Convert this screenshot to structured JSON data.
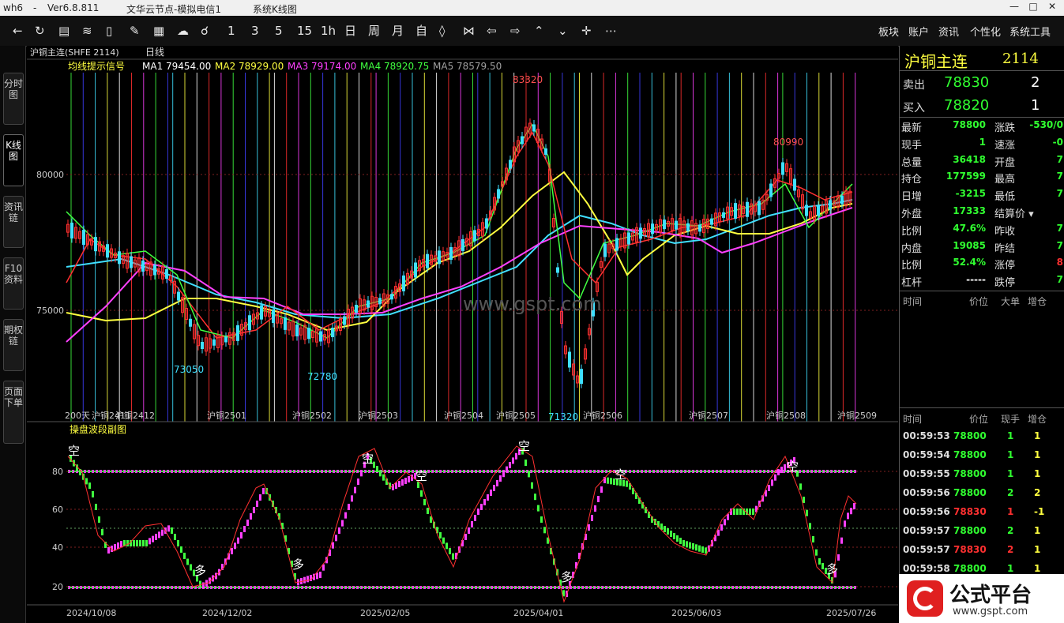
{
  "titlebar": {
    "app": "wh6",
    "version": "Ver6.8.811",
    "server": "文华云节点-模拟电信1",
    "view": "系统K线图"
  },
  "toolbar": {
    "periods": [
      "1",
      "3",
      "5",
      "15",
      "1h",
      "日",
      "周",
      "月",
      "自"
    ],
    "menus": [
      "板块",
      "账户",
      "资讯",
      "个性化",
      "系统工具"
    ]
  },
  "leftbar": {
    "tabs": [
      "分时图",
      "K线图",
      "资讯链",
      "F10资料",
      "期权链",
      "页面下单"
    ]
  },
  "chart": {
    "symbol_label": "沪铜主连(SHFE 2114)",
    "period_label": "日线",
    "indicator_label": "均线提示信号",
    "ma": [
      {
        "name": "MA1",
        "value": "79454.00",
        "color": "#ffffff"
      },
      {
        "name": "MA2",
        "value": "78929.00",
        "color": "#ffff40"
      },
      {
        "name": "MA3",
        "value": "79174.00",
        "color": "#ff40ff"
      },
      {
        "name": "MA4",
        "value": "78920.75",
        "color": "#40ff40"
      },
      {
        "name": "MA5",
        "value": "78579.50",
        "color": "#a0a0a0"
      }
    ],
    "y_ticks": [
      "80000",
      "75000"
    ],
    "annotations": [
      "83320",
      "80990",
      "73050",
      "72780",
      "71320"
    ],
    "contracts": [
      "200天",
      "沪铜2411",
      "沪铜2412",
      "沪铜2501",
      "沪铜2502",
      "沪铜2503",
      "沪铜2504",
      "沪铜2505",
      "沪铜2506",
      "沪铜2507",
      "沪铜2508",
      "沪铜2509"
    ],
    "watermark": "www.gspt.com",
    "sub_label": "操盘波段副图",
    "sub_ticks": [
      "80",
      "60",
      "40",
      "20"
    ],
    "sub_marks": [
      "空",
      "空",
      "空",
      "空",
      "空",
      "空",
      "多",
      "多",
      "多",
      "多"
    ],
    "dates": [
      "2024/10/08",
      "2024/12/02",
      "2025/02/05",
      "2025/04/01",
      "2025/06/03",
      "2025/07/26"
    ]
  },
  "quote": {
    "name": "沪铜主连",
    "code": "2114",
    "sell_label": "卖出",
    "sell_price": "78830",
    "sell_vol": "2",
    "buy_label": "买入",
    "buy_price": "78820",
    "buy_vol": "1",
    "rows": [
      [
        "最新",
        "78800",
        "涨跌",
        "-530/0"
      ],
      [
        "现手",
        "1",
        "速涨",
        "-0"
      ],
      [
        "总量",
        "36418",
        "开盘",
        "7"
      ],
      [
        "持仓",
        "177599",
        "最高",
        "7"
      ],
      [
        "日增",
        "-3215",
        "最低",
        "7"
      ],
      [
        "外盘",
        "17333",
        "结算价",
        ""
      ],
      [
        "比例",
        "47.6%",
        "昨收",
        "7"
      ],
      [
        "内盘",
        "19085",
        "昨结",
        "7"
      ],
      [
        "比例",
        "52.4%",
        "涨停",
        "8"
      ],
      [
        "杠杆",
        "-----",
        "跌停",
        "7"
      ]
    ],
    "big_hdr": [
      "时间",
      "价位",
      "大单",
      "增仓"
    ],
    "tick_hdr": [
      "时间",
      "价位",
      "现手",
      "增仓"
    ],
    "ticks": [
      [
        "00:59:53",
        "78800",
        "1",
        "1"
      ],
      [
        "00:59:54",
        "78800",
        "1",
        "1"
      ],
      [
        "00:59:55",
        "78800",
        "1",
        "1"
      ],
      [
        "00:59:56",
        "78800",
        "2",
        "2"
      ],
      [
        "00:59:56",
        "78830",
        "1",
        "-1"
      ],
      [
        "00:59:57",
        "78800",
        "2",
        "1"
      ],
      [
        "00:59:57",
        "78830",
        "2",
        "1"
      ],
      [
        "00:59:58",
        "78800",
        "1",
        "1"
      ]
    ]
  },
  "logo": {
    "text": "公式平台",
    "url": "www.gspt.com"
  }
}
